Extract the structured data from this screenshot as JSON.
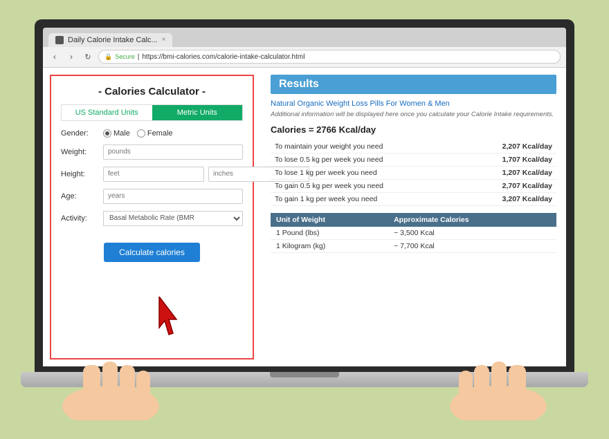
{
  "browser": {
    "tab_title": "Daily Calorie Intake Calc...",
    "tab_favicon": "page",
    "tab_close": "×",
    "back": "‹",
    "forward": "›",
    "refresh": "↻",
    "secure_label": "Secure",
    "url": "https://bmi-calories.com/calorie-intake-calculator.html",
    "lock": "🔒"
  },
  "calculator": {
    "title": "- Calories Calculator -",
    "unit_tabs": [
      {
        "label": "US Standard Units",
        "active": false
      },
      {
        "label": "Metric Units",
        "active": true
      }
    ],
    "gender_label": "Gender:",
    "gender_options": [
      {
        "label": "Male",
        "checked": true
      },
      {
        "label": "Female",
        "checked": false
      }
    ],
    "weight_label": "Weight:",
    "weight_placeholder": "pounds",
    "height_label": "Height:",
    "height_placeholder1": "feet",
    "height_placeholder2": "inches",
    "age_label": "Age:",
    "age_placeholder": "years",
    "activity_label": "Activity:",
    "activity_value": "Basal Metabolic Rate (BMR",
    "calc_button": "Calculate calories"
  },
  "results": {
    "header": "Results",
    "ad_link": "Natural Organic Weight Loss Pills For Women & Men",
    "note": "Additional information will be displayed here once you calculate your Calorie Intake requirements.",
    "calories_summary": "Calories = 2766 Kcal/day",
    "rows": [
      {
        "label": "To maintain your weight you need",
        "value": "2,207 Kcal/day"
      },
      {
        "label": "To lose 0.5 kg per week you need",
        "value": "1,707 Kcal/day"
      },
      {
        "label": "To lose 1 kg per week you need",
        "value": "1,207 Kcal/day"
      },
      {
        "label": "To gain 0.5 kg per week you need",
        "value": "2,707 Kcal/day"
      },
      {
        "label": "To gain 1 kg per week you need",
        "value": "3,207 Kcal/day"
      }
    ],
    "weight_table": {
      "headers": [
        "Unit of Weight",
        "Approximate Calories"
      ],
      "rows": [
        {
          "unit": "1 Pound (lbs)",
          "calories": "~ 3,500 Kcal"
        },
        {
          "unit": "1 Kilogram (kg)",
          "calories": "~ 7,700 Kcal"
        }
      ]
    }
  }
}
